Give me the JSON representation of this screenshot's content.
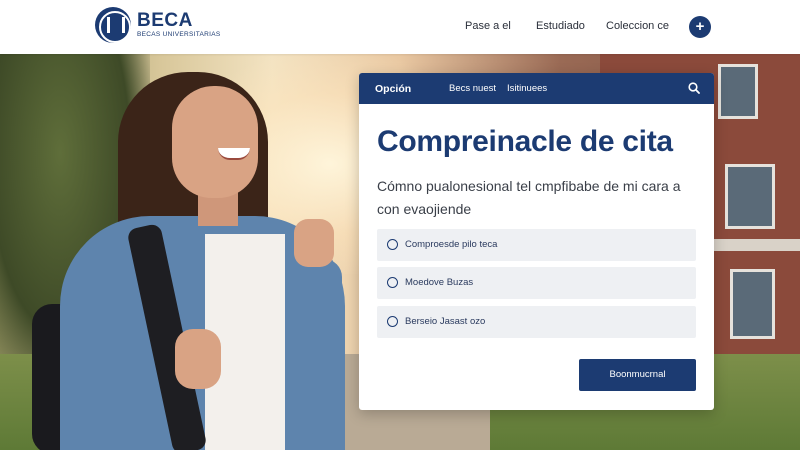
{
  "header": {
    "logo_name": "BECA",
    "logo_sub": "BECAS UNIVERSITARIAS",
    "nav": [
      "Pase a el",
      "Estudiado",
      "Coleccion ce"
    ],
    "plus_icon": "+"
  },
  "card": {
    "bar": {
      "items": [
        "Opción",
        "Becs nuest",
        "Isitinuees"
      ],
      "search_icon": "search-icon"
    },
    "title": "Compreinacle de cita",
    "description": "Cómno pualonesional tel cmpfibabe de mi cara a con evaojiende",
    "options": [
      {
        "label": "Comproesde pilo teca"
      },
      {
        "label": "Moedove Buzas"
      },
      {
        "label": "Berseio Jasast    ozo"
      }
    ],
    "submit_label": "Boonmucrnal"
  },
  "colors": {
    "brand": "#1c3b72",
    "option_bg": "#eef0f3"
  }
}
